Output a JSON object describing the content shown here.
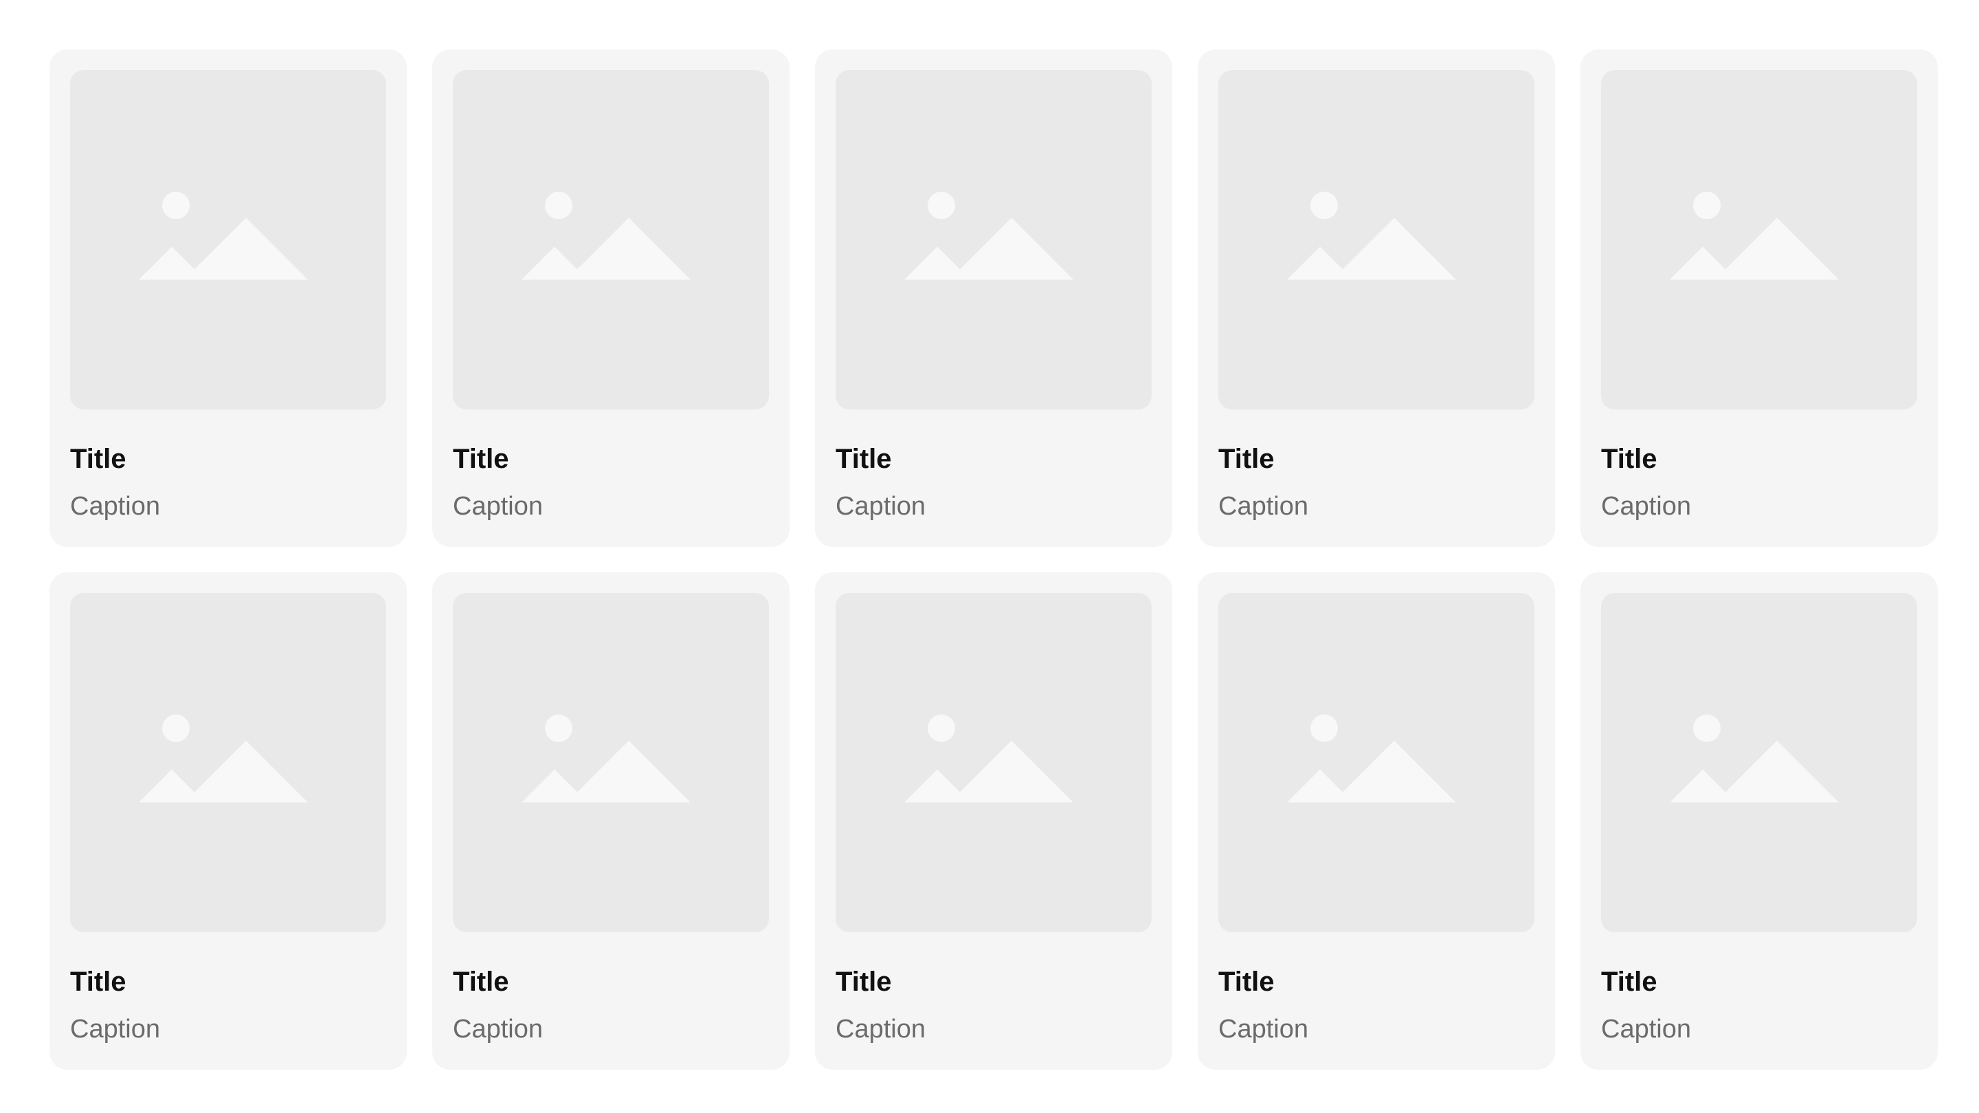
{
  "gallery": {
    "cards": [
      {
        "title": "Title",
        "caption": "Caption",
        "icon": "image-placeholder-icon"
      },
      {
        "title": "Title",
        "caption": "Caption",
        "icon": "image-placeholder-icon"
      },
      {
        "title": "Title",
        "caption": "Caption",
        "icon": "image-placeholder-icon"
      },
      {
        "title": "Title",
        "caption": "Caption",
        "icon": "image-placeholder-icon"
      },
      {
        "title": "Title",
        "caption": "Caption",
        "icon": "image-placeholder-icon"
      },
      {
        "title": "Title",
        "caption": "Caption",
        "icon": "image-placeholder-icon"
      },
      {
        "title": "Title",
        "caption": "Caption",
        "icon": "image-placeholder-icon"
      },
      {
        "title": "Title",
        "caption": "Caption",
        "icon": "image-placeholder-icon"
      },
      {
        "title": "Title",
        "caption": "Caption",
        "icon": "image-placeholder-icon"
      },
      {
        "title": "Title",
        "caption": "Caption",
        "icon": "image-placeholder-icon"
      }
    ]
  },
  "colors": {
    "page_background": "#ffffff",
    "card_background": "#f5f5f5",
    "thumbnail_background": "#e9e9e9",
    "icon_fill": "#f8f8f8",
    "title_text": "#111111",
    "caption_text": "#6b6b6b"
  }
}
